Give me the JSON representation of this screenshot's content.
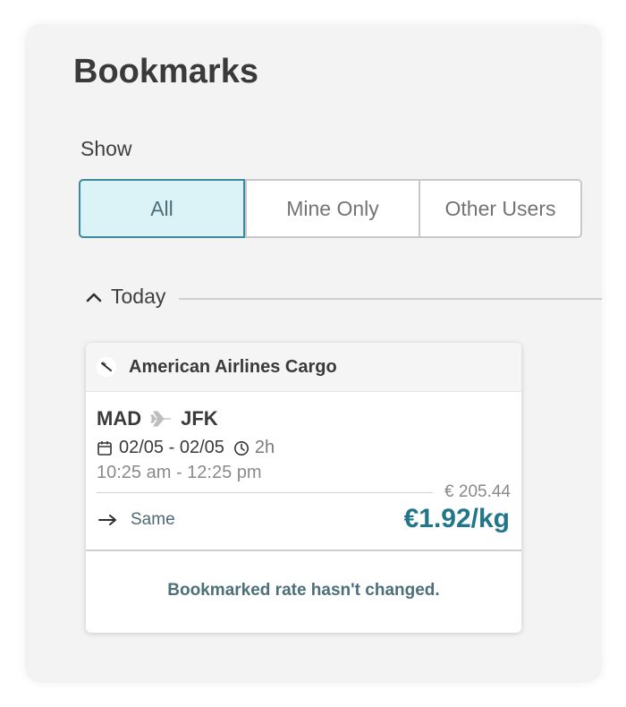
{
  "page": {
    "title": "Bookmarks"
  },
  "filter": {
    "label": "Show",
    "options": [
      "All",
      "Mine Only",
      "Other Users"
    ],
    "selected": "All"
  },
  "group": {
    "label": "Today",
    "expanded": true
  },
  "bookmark": {
    "airline": "American Airlines Cargo",
    "origin": "MAD",
    "destination": "JFK",
    "date_range": "02/05 - 02/05",
    "duration": "2h",
    "time_range": "10:25 am - 12:25 pm",
    "total_price": "€ 205.44",
    "rate": "€1.92/kg",
    "trend_label": "Same",
    "status_message": "Bookmarked rate hasn't changed."
  },
  "colors": {
    "accent": "#22768a",
    "selected_bg": "#dbf2f6",
    "selected_border": "#3b8999",
    "panel_bg": "#f3f3f3"
  },
  "icons": {
    "collapse": "chevron-up-icon",
    "airline": "airline-logo-icon",
    "route_separator": "plane-icon",
    "date": "calendar-icon",
    "duration": "clock-icon",
    "trend": "arrow-right-icon"
  }
}
